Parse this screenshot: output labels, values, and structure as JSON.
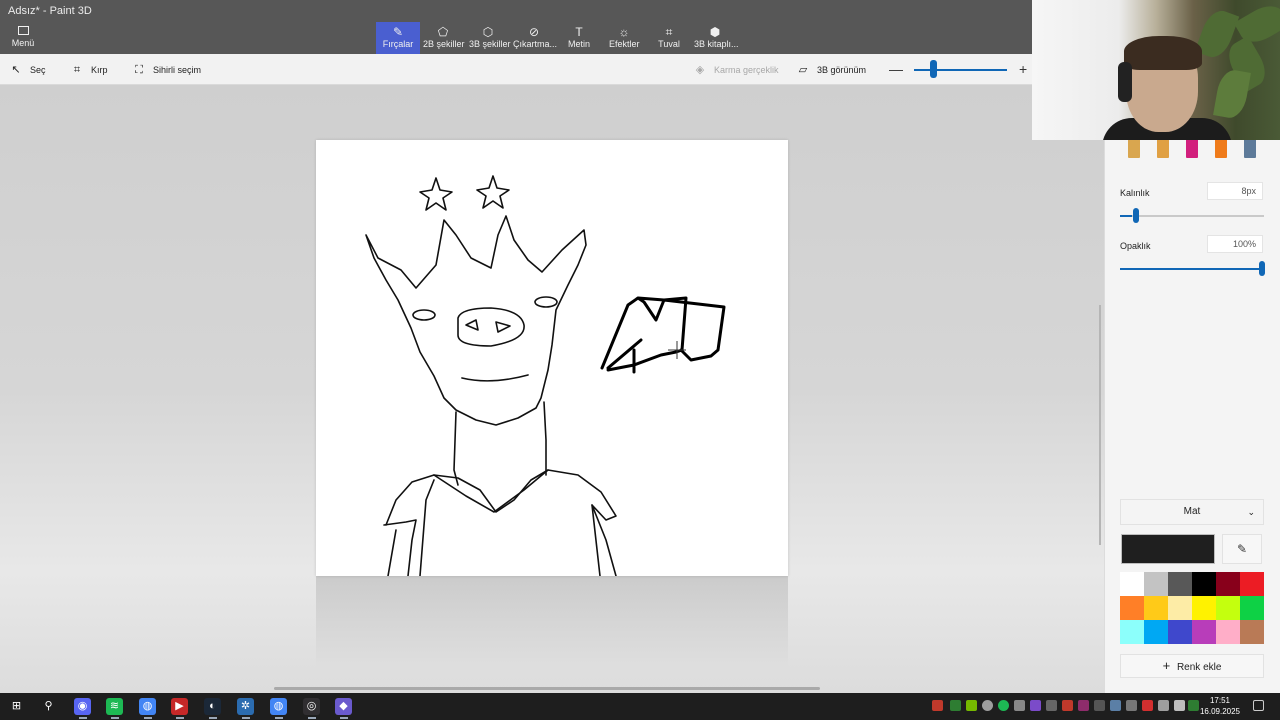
{
  "window": {
    "title": "Adsız* - Paint 3D"
  },
  "ribbon": {
    "menu_label": "Menü",
    "tabs": [
      {
        "label": "Fırçalar",
        "icon": "brush-icon",
        "active": true
      },
      {
        "label": "2B şekiller",
        "icon": "shapes-2d-icon",
        "active": false
      },
      {
        "label": "3B şekiller",
        "icon": "cube-icon",
        "active": false
      },
      {
        "label": "Çıkartma...",
        "icon": "sticker-icon",
        "active": false
      },
      {
        "label": "Metin",
        "icon": "text-icon",
        "active": false
      },
      {
        "label": "Efektler",
        "icon": "sun-icon",
        "active": false
      },
      {
        "label": "Tuval",
        "icon": "canvas-icon",
        "active": false
      },
      {
        "label": "3B kitaplı...",
        "icon": "library-icon",
        "active": false
      }
    ]
  },
  "toolbar": {
    "select_label": "Seç",
    "crop_label": "Kırp",
    "magic_select_label": "Sihirli seçim",
    "mixed_reality_label": "Karma gerçeklik",
    "view_3d_label": "3B görünüm",
    "zoom_minus": "—",
    "zoom_plus": "+",
    "zoom_level": 0.2
  },
  "panel": {
    "thickness_label": "Kalınlık",
    "thickness_value": "8px",
    "thickness_fraction": 0.08,
    "opacity_label": "Opaklık",
    "opacity_value": "100%",
    "opacity_fraction": 1.0,
    "finish_label": "Mat",
    "current_color": "#1f1f1f",
    "add_color_label": "Renk ekle",
    "brushes": [
      {
        "name": "pencil",
        "color": "#d9a64f"
      },
      {
        "name": "marker",
        "color": "#e0a043"
      },
      {
        "name": "calligraphy-pen",
        "color": "#d21f7d"
      },
      {
        "name": "crayon",
        "color": "#ef7b1a"
      },
      {
        "name": "spray-can",
        "color": "#5d7a99"
      }
    ],
    "palette": [
      "#ffffff",
      "#c3c3c3",
      "#585858",
      "#000000",
      "#88001b",
      "#ec1c24",
      "#ff7f27",
      "#ffca18",
      "#fdeca6",
      "#fff200",
      "#c4ff0e",
      "#0ed145",
      "#8cfffb",
      "#00a8f3",
      "#3f48cc",
      "#b83dba",
      "#ffaec8",
      "#b97a56"
    ]
  },
  "taskbar": {
    "time": "17:51",
    "date": "16.09.2025",
    "apps": [
      {
        "name": "windows-start-icon",
        "color": "#1e1e1e",
        "glyph": "⊞"
      },
      {
        "name": "search-icon",
        "color": "#1e1e1e",
        "glyph": "⚲"
      },
      {
        "name": "discord-icon",
        "color": "#5865f2",
        "glyph": "◉"
      },
      {
        "name": "spotify-icon",
        "color": "#1db954",
        "glyph": "≋"
      },
      {
        "name": "chrome-icon",
        "color": "#4285f4",
        "glyph": "◍"
      },
      {
        "name": "video-editor-icon",
        "color": "#c62828",
        "glyph": "▶"
      },
      {
        "name": "steam-icon",
        "color": "#1b2838",
        "glyph": "◐"
      },
      {
        "name": "app-gear-icon",
        "color": "#2b6cb0",
        "glyph": "✲"
      },
      {
        "name": "chrome-icon-2",
        "color": "#4285f4",
        "glyph": "◍"
      },
      {
        "name": "obs-icon",
        "color": "#302e31",
        "glyph": "◎"
      },
      {
        "name": "paint3d-icon",
        "color": "#6a5acd",
        "glyph": "◆"
      }
    ]
  }
}
